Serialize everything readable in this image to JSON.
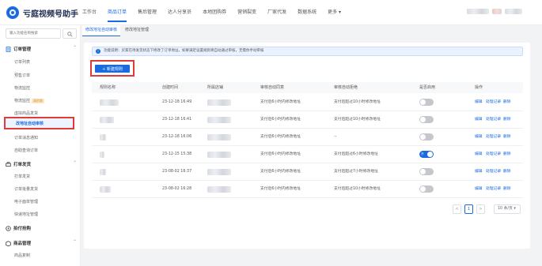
{
  "app": {
    "title": "亏庭视频号助手"
  },
  "topnav": [
    {
      "label": "工作台"
    },
    {
      "label": "商品订单",
      "active": true
    },
    {
      "label": "售后管理"
    },
    {
      "label": "达人分享员"
    },
    {
      "label": "本地团购券"
    },
    {
      "label": "营销裂变"
    },
    {
      "label": "厂家代发"
    },
    {
      "label": "数据系统"
    },
    {
      "label": "更多 ▾"
    }
  ],
  "sidebar": {
    "search_placeholder": "输入功能名称搜索",
    "groups": [
      {
        "label": "订单管理",
        "icon": "order-icon",
        "items": [
          {
            "label": "订单列表"
          },
          {
            "label": "预售订单"
          },
          {
            "label": "物流监控"
          },
          {
            "label": "物流监控",
            "badge": "高阶版"
          },
          {
            "label": "虚拟商品发货"
          },
          {
            "label": "改地址自动审核",
            "active": true
          },
          {
            "label": "订单消息通知"
          },
          {
            "label": "自助查询订单"
          }
        ]
      },
      {
        "label": "打单发货",
        "icon": "print-icon",
        "items": [
          {
            "label": "打单发货"
          },
          {
            "label": "订单批量发货"
          },
          {
            "label": "电子面单管理"
          },
          {
            "label": "快递地址管理"
          }
        ]
      },
      {
        "label": "拍付抢购",
        "icon": "bolt-icon",
        "items": []
      },
      {
        "label": "商品管理",
        "icon": "goods-icon",
        "items": [
          {
            "label": "商品复制"
          }
        ]
      }
    ]
  },
  "tabs": [
    {
      "label": "修改地址自动审核",
      "active": true
    },
    {
      "label": "修改地址管理"
    }
  ],
  "notice": {
    "icon": "info-icon",
    "text": "功能说明：买家在待发货状态下修改了订单地址，如果满足设置规则将自动通过审核，无需你手动审核"
  },
  "new_rule_button": "+ 新建规则",
  "table": {
    "headers": [
      "规则名称",
      "创建时间",
      "所属店铺",
      "审核自动同意",
      "审核自动拒绝",
      "是否启用",
      "操作"
    ],
    "rows": [
      {
        "time": "23-12-18 16:49",
        "agree": "支付后6小时内修改地址",
        "reject": "支付后超过10小时修改地址",
        "enabled": false
      },
      {
        "time": "23-12-18 16:41",
        "agree": "支付后6小时内修改地址",
        "reject": "支付后超过10小时修改地址",
        "enabled": false
      },
      {
        "time": "23-12-18 16:06",
        "agree": "支付后6小时内修改地址",
        "reject": "--",
        "enabled": false
      },
      {
        "time": "23-12-15 15:38",
        "agree": "支付后6小时内修改地址",
        "reject": "支付后超过6小时修改地址",
        "enabled": true
      },
      {
        "time": "23-08-02 16:37",
        "agree": "支付后6小时内修改地址",
        "reject": "支付后超过7小时修改地址",
        "enabled": false
      },
      {
        "time": "23-08-02 16:28",
        "agree": "支付后6小时内修改地址",
        "reject": "支付后超过10小时修改地址",
        "enabled": false
      }
    ],
    "actions": [
      "编辑",
      "处理记录",
      "删除"
    ],
    "toggle_on_label": "开"
  },
  "pagination": {
    "prev": "<",
    "page": "1",
    "next": ">",
    "size": "10 条/页 ▾"
  },
  "colors": {
    "accent": "#1a6be0",
    "highlight": "#e03a3a"
  }
}
